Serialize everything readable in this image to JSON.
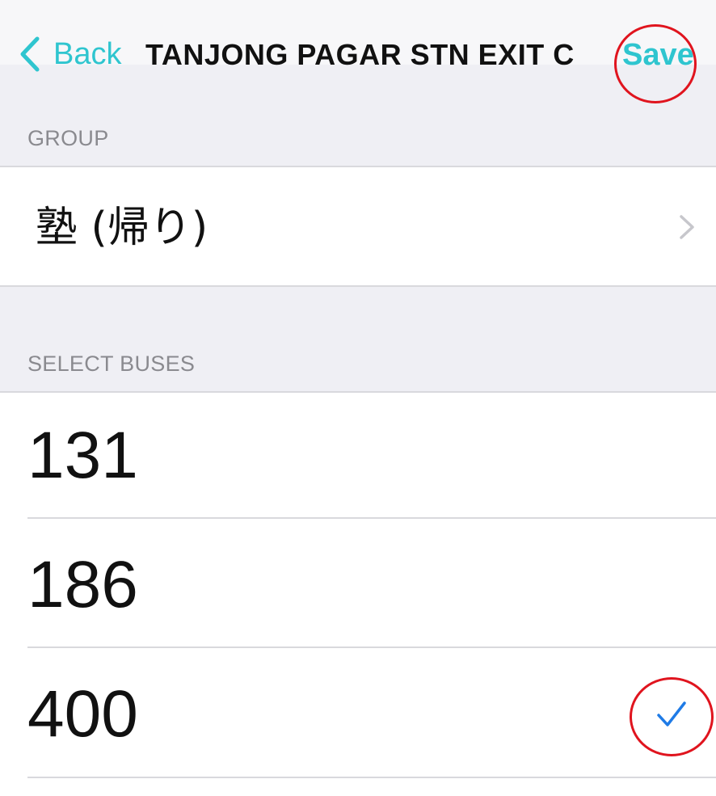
{
  "navbar": {
    "back_label": "Back",
    "title": "TANJONG PAGAR STN EXIT C",
    "save_label": "Save",
    "back_icon": "chevron-left-icon"
  },
  "group_section": {
    "header": "GROUP",
    "value": "塾 (帰り)",
    "disclosure_icon": "chevron-right-icon"
  },
  "buses_section": {
    "header": "SELECT BUSES",
    "items": [
      {
        "label": "131",
        "selected": false
      },
      {
        "label": "186",
        "selected": false
      },
      {
        "label": "400",
        "selected": true
      }
    ],
    "check_icon": "checkmark-icon"
  },
  "annotations": {
    "color": "#e0141e",
    "marks": [
      "save-button-highlight",
      "checkmark-highlight"
    ]
  },
  "colors": {
    "accent": "#2fc5cf",
    "check": "#1f7be6",
    "background": "#efeff4"
  }
}
